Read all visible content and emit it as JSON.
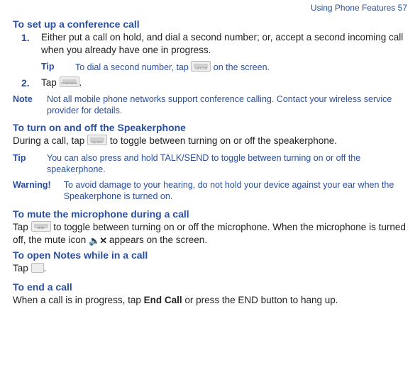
{
  "header": {
    "text": "Using Phone Features  57"
  },
  "s1": {
    "title": "To set up a conference call",
    "step1_num": "1.",
    "step1_text": "Either put a call on hold, and dial a second number; or, accept a second incoming call when you already have one in progress.",
    "tip_label": "Tip",
    "tip_pre": "To dial a second number, tap ",
    "tip_post": " on the screen.",
    "step2_num": "2.",
    "step2_pre": "Tap ",
    "step2_post": ".",
    "note_label": "Note",
    "note_text": "Not all mobile phone networks support conference calling. Contact your wireless service provider for details."
  },
  "s2": {
    "title": "To turn on and off the Speakerphone",
    "body_pre": "During a call, tap ",
    "body_post": " to toggle between turning on or off the speakerphone.",
    "tip_label": "Tip",
    "tip_text": "You can also press and hold TALK/SEND to toggle between turning on or off the speakerphone.",
    "warn_label": "Warning!",
    "warn_text": "To avoid damage to your hearing, do not hold your device against your ear when the Speakerphone is turned on."
  },
  "s3": {
    "title": "To mute the microphone during a call",
    "body_pre": "Tap ",
    "body_mid": " to toggle between turning on or off the microphone. When the microphone is turned off, the mute icon ",
    "body_post": " appears on the screen."
  },
  "s4": {
    "title": "To open Notes while in a call",
    "body_pre": "Tap ",
    "body_post": "."
  },
  "s5": {
    "title": "To end a call",
    "body_pre": "When a call is in progress, tap ",
    "body_bold": "End Call",
    "body_post": " or press the END button to hang up."
  },
  "icons": {
    "addcall": "Add Call",
    "conference": "Conference",
    "speaker": "Speaker",
    "mute": "Mute"
  }
}
